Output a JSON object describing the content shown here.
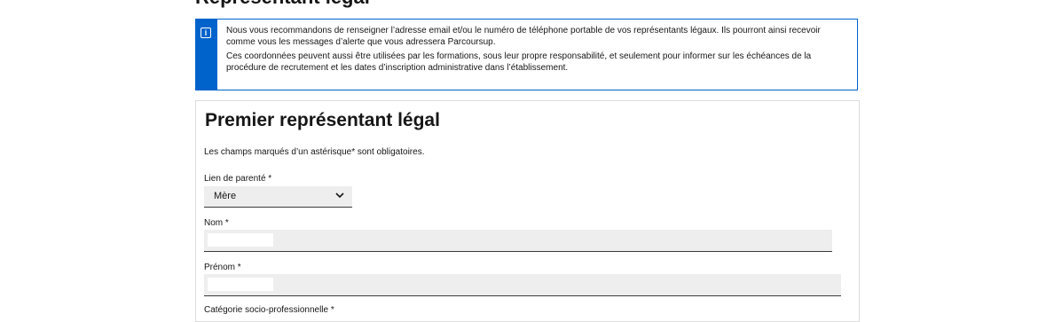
{
  "page": {
    "heading": "Représentant légal"
  },
  "notice": {
    "icon": "info-icon",
    "paragraph1": "Nous vous recommandons de renseigner l’adresse email et/ou le numéro de téléphone portable de vos représentants légaux. Ils pourront ainsi recevoir comme vous les messages d’alerte que vous adressera Parcoursup.",
    "paragraph2": "Ces coordonnées peuvent aussi être utilisées par les formations, sous leur propre responsabilité, et seulement pour informer sur les échéances de la procédure de recrutement et les dates d’inscription administrative dans l’établissement.",
    "accent_color": "#0063cb"
  },
  "form": {
    "title": "Premier représentant légal",
    "required_note": "Les champs marqués d’un astérisque* sont obligatoires.",
    "relationship": {
      "label": "Lien de parenté *",
      "value": "Mère",
      "icon": "chevron-down-icon"
    },
    "last_name": {
      "label": "Nom *",
      "value": ""
    },
    "first_name": {
      "label": "Prénom *",
      "value": ""
    },
    "category": {
      "label": "Catégorie socio-professionnelle *"
    }
  }
}
